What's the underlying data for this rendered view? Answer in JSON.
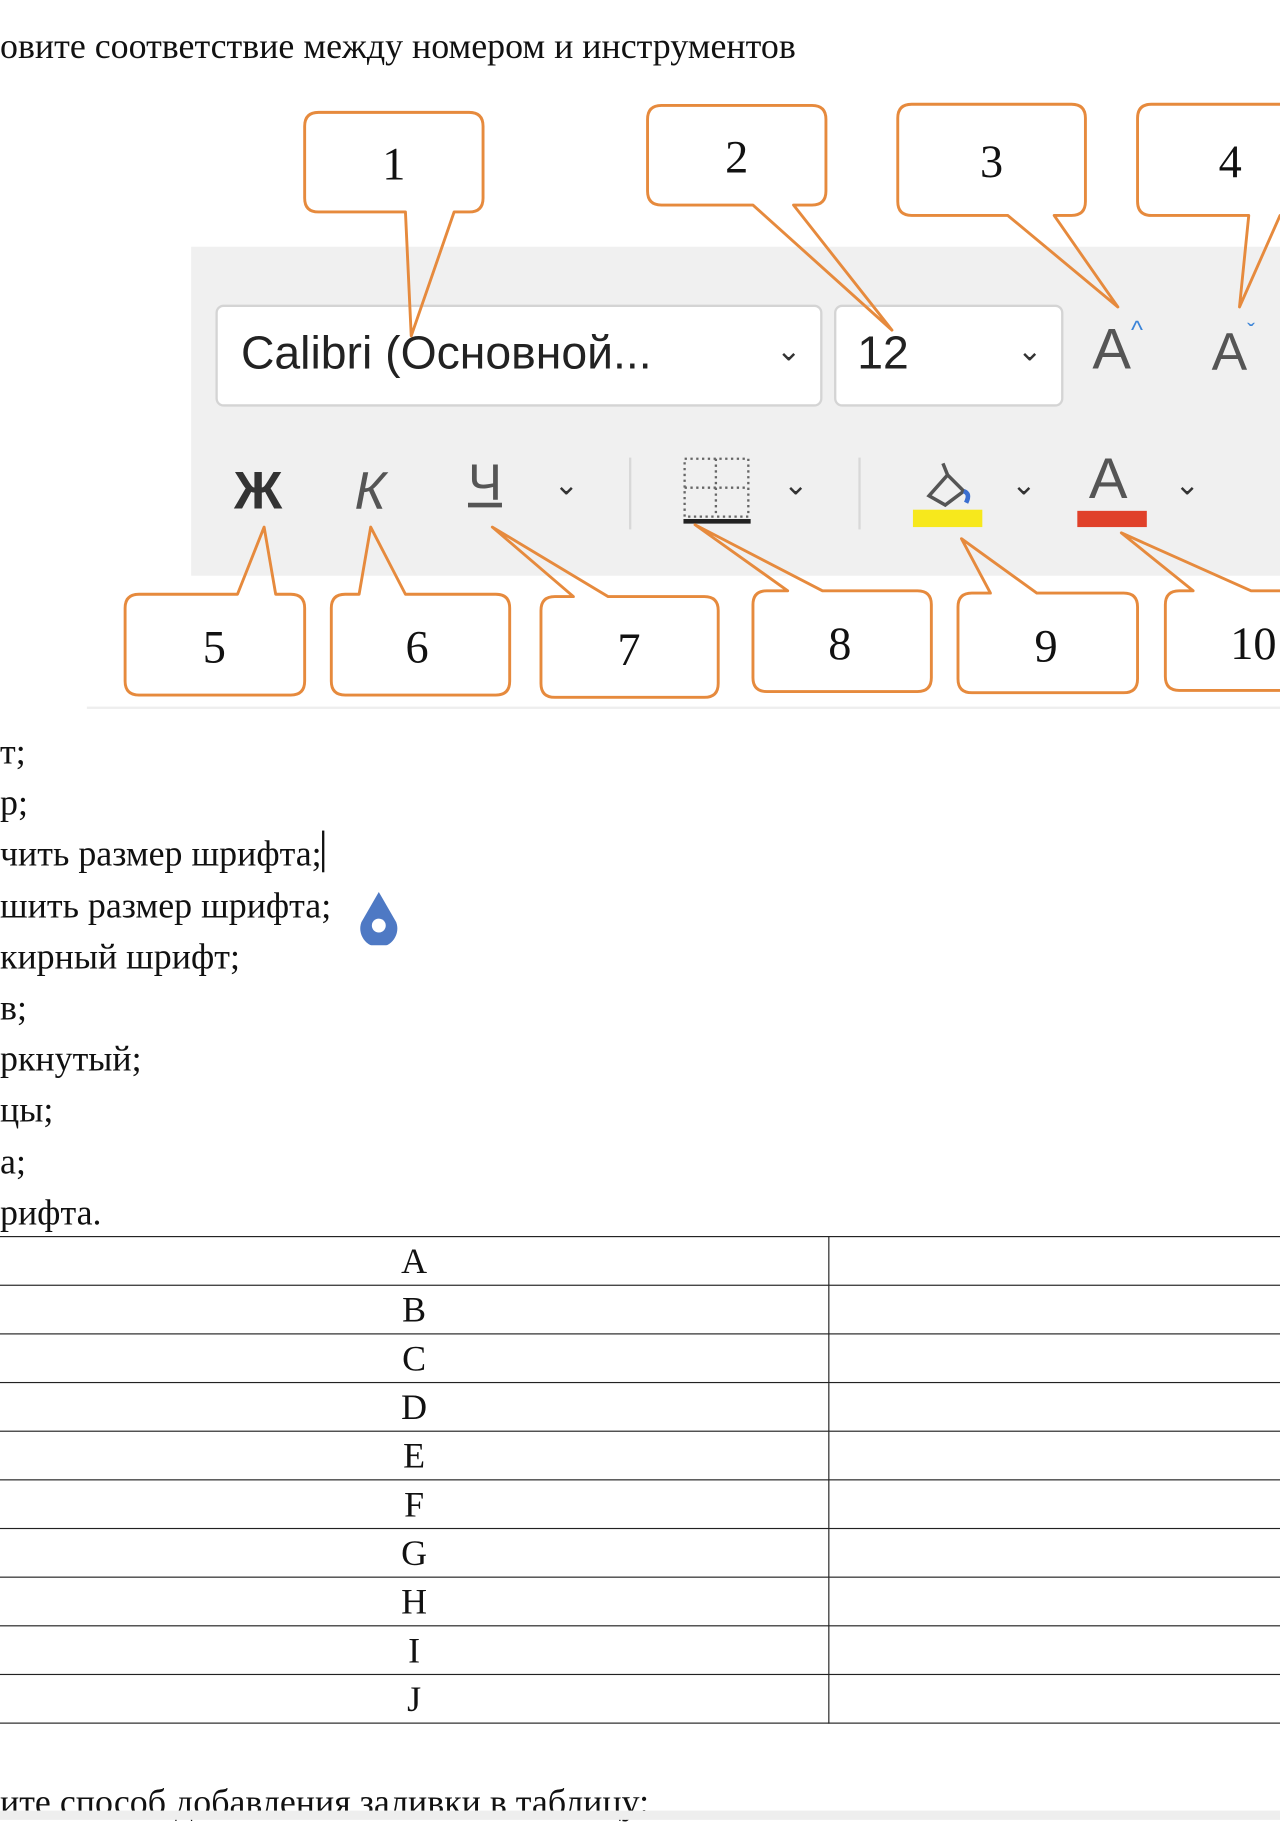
{
  "title": "овите соответствие между номером и инструментов",
  "toolbar": {
    "font_name": "Calibri (Основной...",
    "font_size": "12",
    "grow_font_label": "A",
    "shrink_font_label": "A",
    "bold_label": "Ж",
    "italic_label": "К",
    "underline_label": "Ч",
    "font_color_label": "A",
    "chevron": "⌄",
    "highlight_color": "#f7e81c",
    "font_color": "#e0412a",
    "callout_color": "#e68a3d"
  },
  "callouts": [
    "1",
    "2",
    "3",
    "4",
    "5",
    "6",
    "7",
    "8",
    "9",
    "10"
  ],
  "options": [
    "т;",
    "р;",
    "чить размер шрифта;",
    "шить размер шрифта;",
    "кирный шрифт;",
    "в;",
    "ркнутый;",
    "цы;",
    "а;",
    "рифта."
  ],
  "table": {
    "rows": [
      {
        "letter": "A",
        "answer": ""
      },
      {
        "letter": "B",
        "answer": ""
      },
      {
        "letter": "C",
        "answer": ""
      },
      {
        "letter": "D",
        "answer": ""
      },
      {
        "letter": "E",
        "answer": ""
      },
      {
        "letter": "F",
        "answer": ""
      },
      {
        "letter": "G",
        "answer": ""
      },
      {
        "letter": "H",
        "answer": ""
      },
      {
        "letter": "I",
        "answer": ""
      },
      {
        "letter": "J",
        "answer": ""
      }
    ]
  },
  "next_question": "ите способ добавления заливки в таблицу:"
}
